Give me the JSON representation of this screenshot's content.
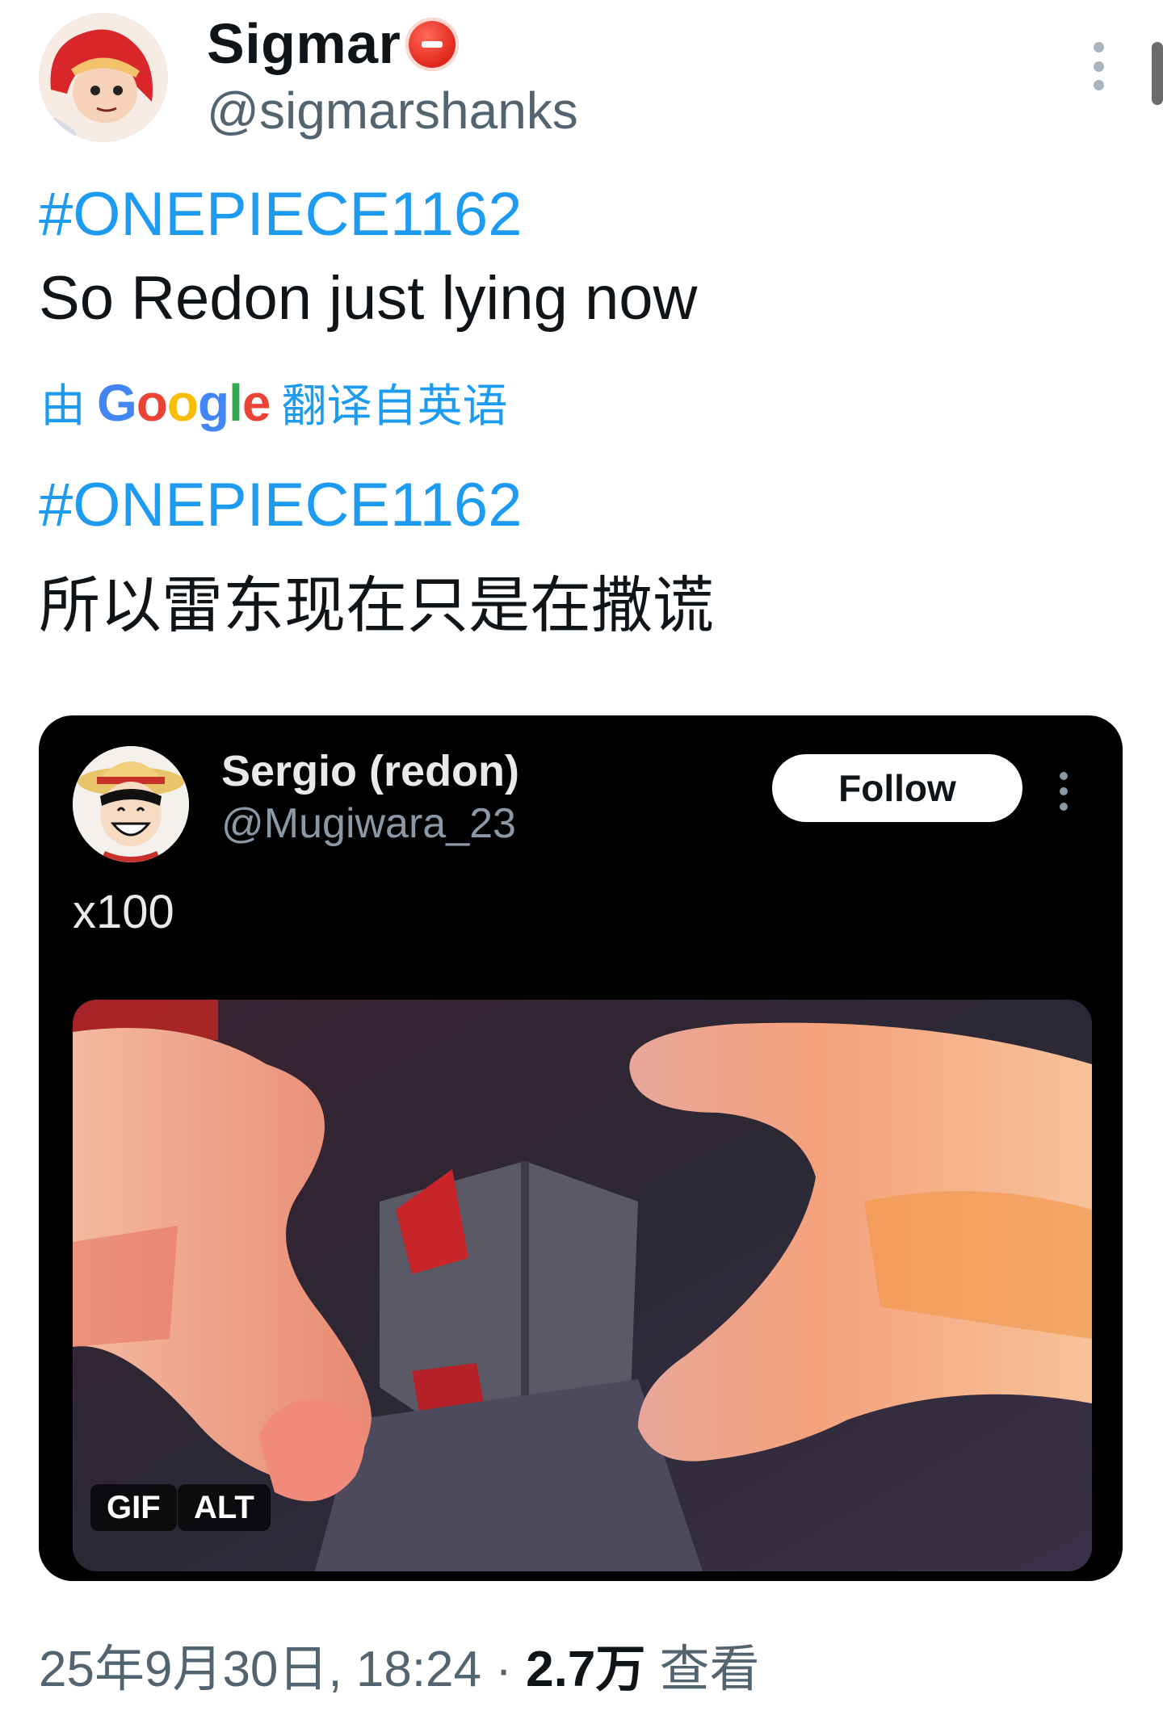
{
  "author": {
    "display_name": "Sigmar",
    "handle": "@sigmarshanks"
  },
  "tweet": {
    "hashtag": "#ONEPIECE1162",
    "text": "So Redon just lying now",
    "translation_prefix": "由",
    "translation_provider": "Google",
    "translation_suffix": "翻译自英语",
    "translated_hashtag": "#ONEPIECE1162",
    "translated_text": "所以雷东现在只是在撒谎"
  },
  "embedded_post": {
    "display_name": "Sergio (redon)",
    "handle": "@Mugiwara_23",
    "follow_label": "Follow",
    "text": "x100",
    "badges": {
      "gif": "GIF",
      "alt": "ALT"
    }
  },
  "meta": {
    "date_time": "25年9月30日, 18:24",
    "separator": " · ",
    "views_count": "2.7万",
    "views_label": " 查看"
  },
  "colors": {
    "link": "#1d9bf0",
    "text": "#0f1419",
    "muted": "#536471",
    "card_bg": "#000000",
    "verified": "#e22a1e"
  },
  "icons": [
    "more-vertical-icon",
    "verified-badge-icon",
    "embed-more-icon"
  ]
}
